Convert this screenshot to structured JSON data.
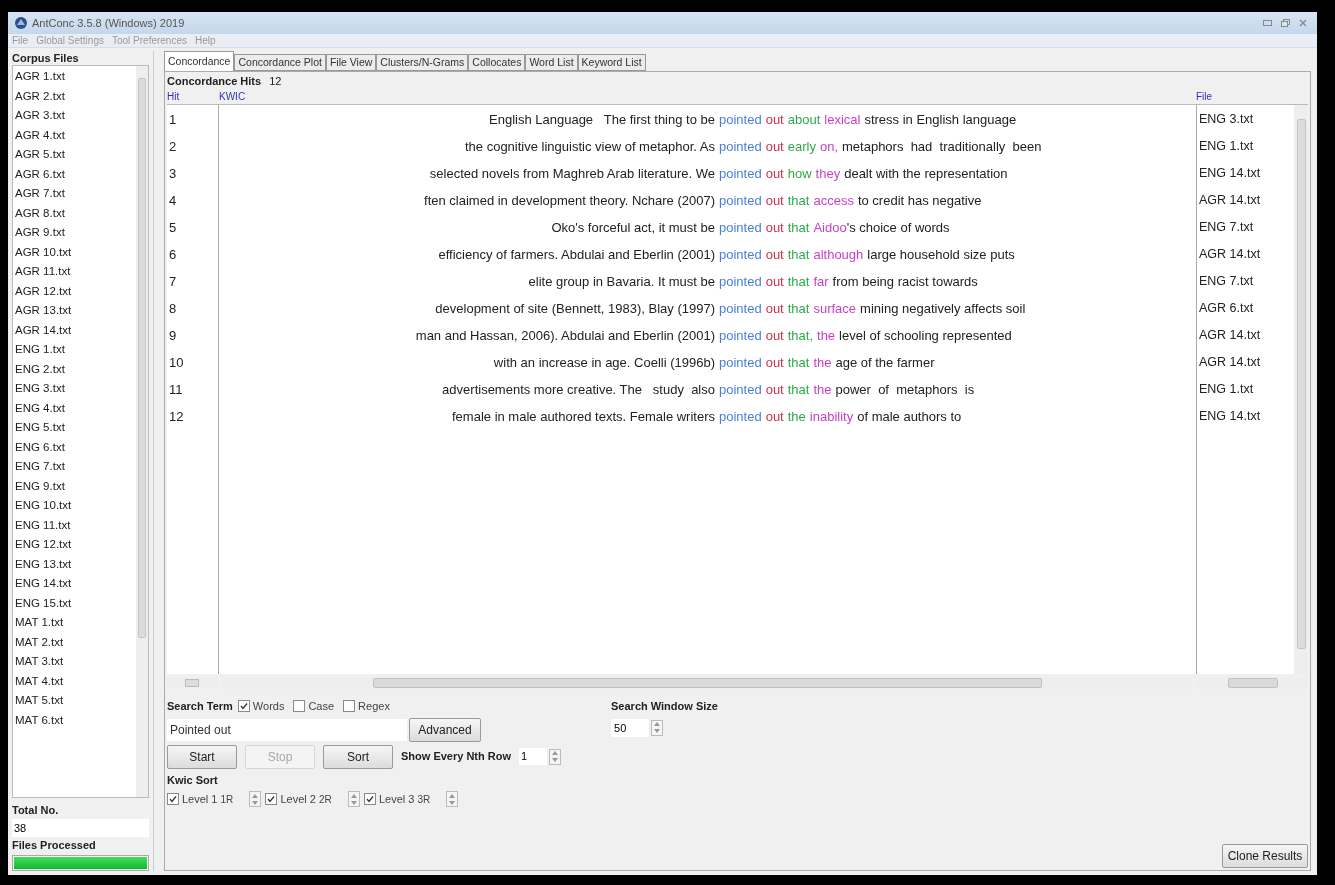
{
  "window": {
    "title": "AntConc 3.5.8 (Windows) 2019"
  },
  "menu": [
    "File",
    "Global Settings",
    "Tool Preferences",
    "Help"
  ],
  "corpus_files": {
    "label": "Corpus Files",
    "items": [
      "AGR 1.txt",
      "AGR 2.txt",
      "AGR 3.txt",
      "AGR 4.txt",
      "AGR 5.txt",
      "AGR 6.txt",
      "AGR 7.txt",
      "AGR 8.txt",
      "AGR 9.txt",
      "AGR 10.txt",
      "AGR 11.txt",
      "AGR 12.txt",
      "AGR 13.txt",
      "AGR 14.txt",
      "ENG 1.txt",
      "ENG 2.txt",
      "ENG 3.txt",
      "ENG 4.txt",
      "ENG 5.txt",
      "ENG 6.txt",
      "ENG 7.txt",
      "ENG 9.txt",
      "ENG 10.txt",
      "ENG 11.txt",
      "ENG 12.txt",
      "ENG 13.txt",
      "ENG 14.txt",
      "ENG 15.txt",
      "MAT 1.txt",
      "MAT 2.txt",
      "MAT 3.txt",
      "MAT 4.txt",
      "MAT 5.txt",
      "MAT 6.txt"
    ],
    "total_label": "Total No.",
    "total": "38",
    "processed_label": "Files Processed",
    "progress": {
      "level": 1
    }
  },
  "tabs": [
    {
      "label": "Concordance",
      "selected": true
    },
    {
      "label": "Concordance Plot",
      "selected": false
    },
    {
      "label": "File View",
      "selected": false
    },
    {
      "label": "Clusters/N-Grams",
      "selected": false
    },
    {
      "label": "Collocates",
      "selected": false
    },
    {
      "label": "Word List",
      "selected": false
    },
    {
      "label": "Keyword List",
      "selected": false
    }
  ],
  "concordance": {
    "hits_label": "Concordance Hits",
    "hits": "12",
    "columns": [
      "Hit",
      "KWIC",
      "File"
    ],
    "rows": [
      {
        "hit": "1",
        "left": "English Language   The first thing to be",
        "segments": [
          {
            "text": "pointed",
            "color": "#4a7fd8"
          },
          {
            "text": "out",
            "color": "#d0304a"
          },
          {
            "text": "about",
            "color": "#2fa84a"
          },
          {
            "text": "lexical",
            "color": "#c93fc9"
          }
        ],
        "right": "stress in English language",
        "joined": false,
        "file": "ENG 3.txt"
      },
      {
        "hit": "2",
        "left": "the cognitive linguistic view of metaphor. As",
        "segments": [
          {
            "text": "pointed",
            "color": "#4a7fd8"
          },
          {
            "text": "out",
            "color": "#d0304a"
          },
          {
            "text": "early",
            "color": "#2fa84a"
          },
          {
            "text": "on,",
            "color": "#c93fc9"
          }
        ],
        "right": "metaphors  had  traditionally  been",
        "joined": false,
        "file": "ENG 1.txt"
      },
      {
        "hit": "3",
        "left": "selected novels from Maghreb Arab literature. We",
        "segments": [
          {
            "text": "pointed",
            "color": "#4a7fd8"
          },
          {
            "text": "out",
            "color": "#d0304a"
          },
          {
            "text": "how",
            "color": "#2fa84a"
          },
          {
            "text": "they",
            "color": "#c93fc9"
          }
        ],
        "right": "dealt with the representation",
        "joined": false,
        "file": "ENG 14.txt"
      },
      {
        "hit": "4",
        "left": "ften claimed in development theory. Nchare (2007)",
        "segments": [
          {
            "text": "pointed",
            "color": "#4a7fd8"
          },
          {
            "text": "out",
            "color": "#d0304a"
          },
          {
            "text": "that",
            "color": "#2fa84a"
          },
          {
            "text": "access",
            "color": "#c93fc9"
          }
        ],
        "right": "to credit has negative",
        "joined": false,
        "file": "AGR 14.txt"
      },
      {
        "hit": "5",
        "left": "Oko's forceful act, it must be",
        "segments": [
          {
            "text": "pointed",
            "color": "#4a7fd8"
          },
          {
            "text": "out",
            "color": "#d0304a"
          },
          {
            "text": "that",
            "color": "#2fa84a"
          },
          {
            "text": "Aidoo",
            "color": "#c93fc9"
          }
        ],
        "right": "'s choice of words",
        "joined": true,
        "file": "ENG 7.txt"
      },
      {
        "hit": "6",
        "left": "efficiency of farmers. Abdulai and Eberlin (2001)",
        "segments": [
          {
            "text": "pointed",
            "color": "#4a7fd8"
          },
          {
            "text": "out",
            "color": "#d0304a"
          },
          {
            "text": "that",
            "color": "#2fa84a"
          },
          {
            "text": "although",
            "color": "#c93fc9"
          }
        ],
        "right": "large household size puts",
        "joined": false,
        "file": "AGR 14.txt"
      },
      {
        "hit": "7",
        "left": "elite group in Bavaria. It must be",
        "segments": [
          {
            "text": "pointed",
            "color": "#4a7fd8"
          },
          {
            "text": "out",
            "color": "#d0304a"
          },
          {
            "text": "that",
            "color": "#2fa84a"
          },
          {
            "text": "far",
            "color": "#c93fc9"
          }
        ],
        "right": "from being racist towards",
        "joined": false,
        "file": "ENG 7.txt"
      },
      {
        "hit": "8",
        "left": "development of site (Bennett, 1983), Blay (1997)",
        "segments": [
          {
            "text": "pointed",
            "color": "#4a7fd8"
          },
          {
            "text": "out",
            "color": "#d0304a"
          },
          {
            "text": "that",
            "color": "#2fa84a"
          },
          {
            "text": "surface",
            "color": "#c93fc9"
          }
        ],
        "right": "mining negatively affects soil",
        "joined": false,
        "file": "AGR 6.txt"
      },
      {
        "hit": "9",
        "left": "man and Hassan, 2006). Abdulai and Eberlin (2001)",
        "segments": [
          {
            "text": "pointed",
            "color": "#4a7fd8"
          },
          {
            "text": "out",
            "color": "#d0304a"
          },
          {
            "text": "that,",
            "color": "#2fa84a"
          },
          {
            "text": "the",
            "color": "#c93fc9"
          }
        ],
        "right": "level of schooling represented",
        "joined": false,
        "file": "AGR 14.txt"
      },
      {
        "hit": "10",
        "left": "with an increase in age. Coelli (1996b)",
        "segments": [
          {
            "text": "pointed",
            "color": "#4a7fd8"
          },
          {
            "text": "out",
            "color": "#d0304a"
          },
          {
            "text": "that",
            "color": "#2fa84a"
          },
          {
            "text": "the",
            "color": "#c93fc9"
          }
        ],
        "right": "age of the farmer",
        "joined": false,
        "file": "AGR 14.txt"
      },
      {
        "hit": "11",
        "left": "advertisements more creative. The   study  also",
        "segments": [
          {
            "text": "pointed",
            "color": "#4a7fd8"
          },
          {
            "text": "out",
            "color": "#d0304a"
          },
          {
            "text": "that",
            "color": "#2fa84a"
          },
          {
            "text": "the",
            "color": "#c93fc9"
          }
        ],
        "right": "power  of  metaphors  is",
        "joined": false,
        "file": "ENG 1.txt"
      },
      {
        "hit": "12",
        "left": "female in male authored texts. Female writers",
        "segments": [
          {
            "text": "pointed",
            "color": "#4a7fd8"
          },
          {
            "text": "out",
            "color": "#d0304a"
          },
          {
            "text": "the",
            "color": "#2fa84a"
          },
          {
            "text": "inability",
            "color": "#c93fc9"
          }
        ],
        "right": "of male authors to",
        "joined": false,
        "file": "ENG 14.txt"
      }
    ]
  },
  "search": {
    "label": "Search Term",
    "options": [
      {
        "label": "Words",
        "checked": true
      },
      {
        "label": "Case",
        "checked": false
      },
      {
        "label": "Regex",
        "checked": false
      }
    ],
    "value": "Pointed out",
    "advanced": "Advanced",
    "buttons": [
      {
        "label": "Start",
        "disabled": false
      },
      {
        "label": "Stop",
        "disabled": true
      },
      {
        "label": "Sort",
        "disabled": false
      }
    ],
    "nth_label": "Show Every Nth Row",
    "nth": "1",
    "window_label": "Search Window Size",
    "window_size": "50"
  },
  "kwic_sort": {
    "label": "Kwic Sort",
    "levels": [
      {
        "label": "Level 1",
        "checked": true,
        "value": "1R"
      },
      {
        "label": "Level 2",
        "checked": true,
        "value": "2R"
      },
      {
        "label": "Level 3",
        "checked": true,
        "value": "3R"
      }
    ]
  },
  "clone_button": "Clone Results"
}
